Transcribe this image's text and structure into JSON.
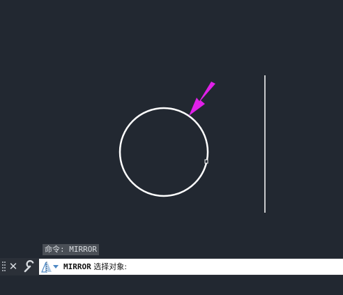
{
  "command_history": "命令: MIRROR",
  "command_line": {
    "command": "MIRROR",
    "prompt": "选择对象:",
    "icons": [
      "grip-icon",
      "close-icon",
      "wrench-icon",
      "mirror-icon",
      "dropdown-arrow-icon"
    ]
  },
  "colors": {
    "background": "#222831",
    "entity": "#ffffff",
    "arrow_annotation": "#e020e8",
    "history_bg": "#4a4f56",
    "input_bg": "#ffffff"
  }
}
